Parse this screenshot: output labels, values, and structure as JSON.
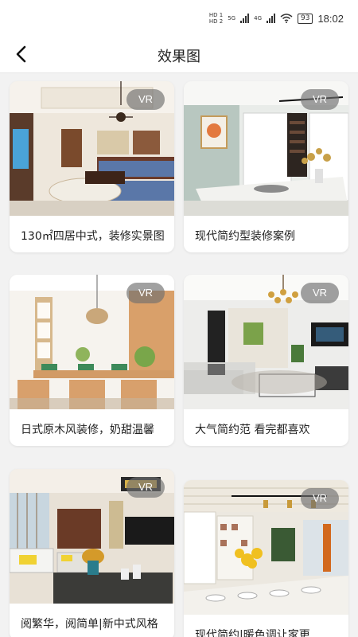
{
  "status": {
    "network": "5G",
    "network2": "4G",
    "hd1": "HD 1",
    "hd2": "HD 2",
    "battery": "93",
    "time": "18:02"
  },
  "header": {
    "title": "效果图"
  },
  "icons": {
    "back": "chevron-left-icon",
    "wifi": "wifi-icon"
  },
  "vr_label": "VR",
  "cards": [
    {
      "title": "130㎡四居中式，装修实景图",
      "vr": "VR"
    },
    {
      "title": "现代简约型装修案例",
      "vr": "VR"
    },
    {
      "title": "日式原木风装修，奶甜温馨",
      "vr": "VR"
    },
    {
      "title": "大气简约范 看完都喜欢",
      "vr": "VR"
    },
    {
      "title": "阅繁华，阅简单|新中式风格",
      "vr": "VR"
    },
    {
      "title": "现代简约|暖色调让家更",
      "vr": "VR"
    }
  ]
}
